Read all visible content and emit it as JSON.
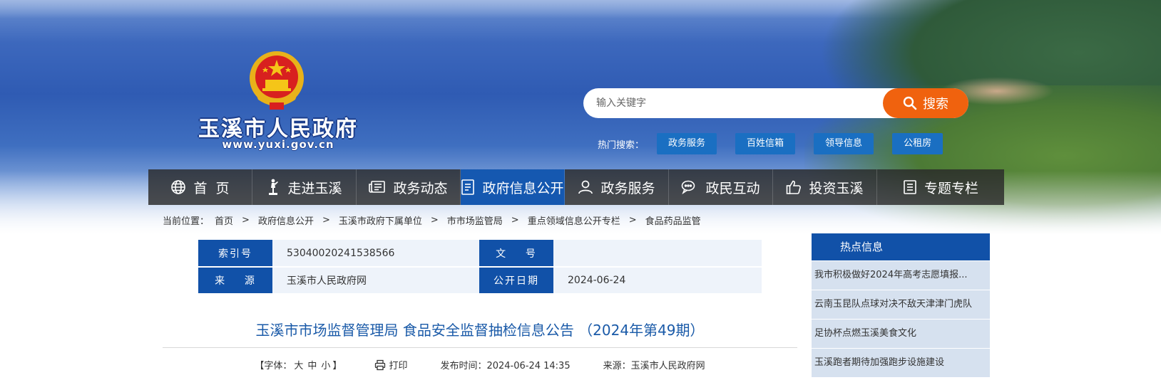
{
  "logo": {
    "title": "玉溪市人民政府",
    "url": "www.yuxi.gov.cn",
    "emblem_icon": "national-emblem-icon"
  },
  "search": {
    "placeholder": "输入关键字",
    "button_label": "搜索"
  },
  "hot_search": {
    "label": "热门搜索：",
    "tags": [
      "政务服务",
      "百姓信箱",
      "领导信息",
      "公租房"
    ]
  },
  "nav": {
    "items": [
      {
        "label": "首  页",
        "icon": "globe-icon"
      },
      {
        "label": "走进玉溪",
        "icon": "statue-icon"
      },
      {
        "label": "政务动态",
        "icon": "newspaper-icon"
      },
      {
        "label": "政府信息公开",
        "icon": "document-icon",
        "active": true
      },
      {
        "label": "政务服务",
        "icon": "person-icon"
      },
      {
        "label": "政民互动",
        "icon": "chat-icon"
      },
      {
        "label": "投资玉溪",
        "icon": "thumbs-up-icon"
      },
      {
        "label": "专题专栏",
        "icon": "list-icon"
      }
    ]
  },
  "breadcrumb": {
    "label": "当前位置：",
    "items": [
      "首页",
      "政府信息公开",
      "玉溪市政府下属单位",
      "市市场监管局",
      "重点领域信息公开专栏",
      "食品药品监管"
    ]
  },
  "info": {
    "index_label": "索引号",
    "index_value": "53040020241538566",
    "doc_label": "文    号",
    "doc_value": "",
    "source_label": "来    源",
    "source_value": "玉溪市人民政府网",
    "date_label": "公开日期",
    "date_value": "2024-06-24"
  },
  "article": {
    "title": "玉溪市市场监督管理局 食品安全监督抽检信息公告 （2024年第49期）",
    "font_label": "【字体：",
    "font_sizes": [
      "大",
      "中",
      "小"
    ],
    "font_end": "】",
    "print_label": "打印",
    "publish_time": "发布时间：2024-06-24 14:35",
    "source": "来源：玉溪市人民政府网"
  },
  "sidebar": {
    "title": "热点信息",
    "items": [
      "我市积极做好2024年高考志愿填报...",
      "云南玉昆队点球对决不敌天津津门虎队",
      "足协杯点燃玉溪美食文化",
      "玉溪跑者期待加强跑步设施建设"
    ]
  },
  "colors": {
    "nav_active": "#1558b0",
    "primary_blue": "#1151a8",
    "search_button": "#f0620e",
    "hot_tag": "#1a6fc2"
  }
}
